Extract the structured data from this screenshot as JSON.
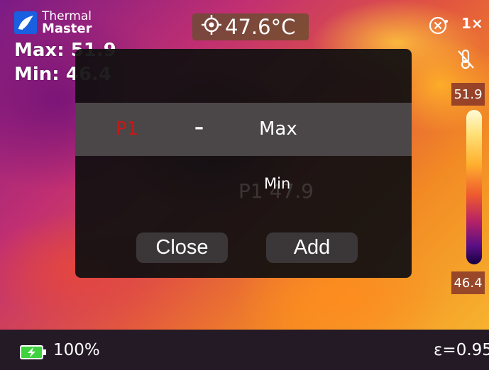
{
  "logo": {
    "line1": "Thermal",
    "line2": "Master",
    "icon": "thermal-master-logo"
  },
  "stats": {
    "max_text": "Max: 51.9",
    "min_text": "Min: 46.4"
  },
  "center_temp": {
    "icon": "crosshair-icon",
    "value": "47.6°C"
  },
  "top_right": {
    "zoom": "1×",
    "close_icon": "circle-close-icon",
    "thermo_icon": "thermometer-off-icon"
  },
  "scale": {
    "top": "51.9",
    "bottom": "46.4",
    "colors": [
      "#fffbd9",
      "#ffb02e",
      "#ee5a2e",
      "#b62266",
      "#5a0f84",
      "#150040"
    ]
  },
  "modal": {
    "point_label": "P1",
    "dash": "–",
    "options": [
      "Max",
      "Min"
    ],
    "selected": "Max",
    "background_ghost": "P1 47.9",
    "close_label": "Close",
    "add_label": "Add"
  },
  "status": {
    "battery_percent": "100%",
    "emissivity": "ε=0.95"
  },
  "colors": {
    "accent_red": "#c41a1a",
    "modal_bg": "#121011",
    "button_bg": "#3b3738",
    "battery_green": "#3fd23f"
  }
}
